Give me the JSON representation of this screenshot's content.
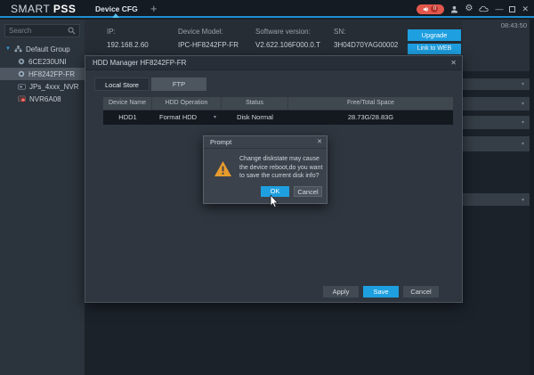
{
  "app": {
    "brand_light": "SMART",
    "brand_bold": "PSS",
    "time": "08:43:50",
    "alarm_count": "0"
  },
  "icons": {
    "plus": "+",
    "gear": "⚙",
    "minimize": "—",
    "close": "✕",
    "chevron_down": "▾",
    "tree_expanded": "▼"
  },
  "tabs": {
    "device_cfg": "Device CFG"
  },
  "sidebar": {
    "search_placeholder": "Search",
    "group_label": "Default Group",
    "devices": [
      {
        "label": "6CE230UNI"
      },
      {
        "label": "HF8242FP-FR"
      },
      {
        "label": "JPs_4xxx_NVR"
      },
      {
        "label": "NVR6A08"
      }
    ]
  },
  "device_info": {
    "fields": [
      {
        "label": "IP:",
        "value": "192.168.2.60"
      },
      {
        "label": "Device Model:",
        "value": "IPC-HF8242FP-FR"
      },
      {
        "label": "Software version:",
        "value": "V2.622.106F000.0.T"
      },
      {
        "label": "SN:",
        "value": "3H04D70YAG00002"
      }
    ],
    "upgrade_label": "Upgrade",
    "link_web_label": "Link to WEB"
  },
  "hdd_manager": {
    "title": "HDD Manager HF8242FP-FR",
    "tab_local": "Local Store",
    "tab_ftp": "FTP",
    "table": {
      "headers": [
        "Device Name",
        "HDD Operation",
        "Status",
        "Free/Total Space"
      ],
      "row": {
        "device_name": "HDD1",
        "hdd_operation": "Format HDD",
        "status": "Disk Normal",
        "free_total": "28.73G/28.83G"
      }
    },
    "footer": {
      "apply": "Apply",
      "save": "Save",
      "cancel": "Cancel"
    }
  },
  "prompt": {
    "title": "Prompt",
    "message": "Change diskstate may cause the device reboot,do you want to save the current disk info?",
    "ok": "OK",
    "cancel": "Cancel"
  },
  "colors": {
    "accent": "#1e9fe0",
    "alarm": "#e2574c",
    "warning": "#e89b2d",
    "titlebar_border": "#1d8fd0"
  }
}
